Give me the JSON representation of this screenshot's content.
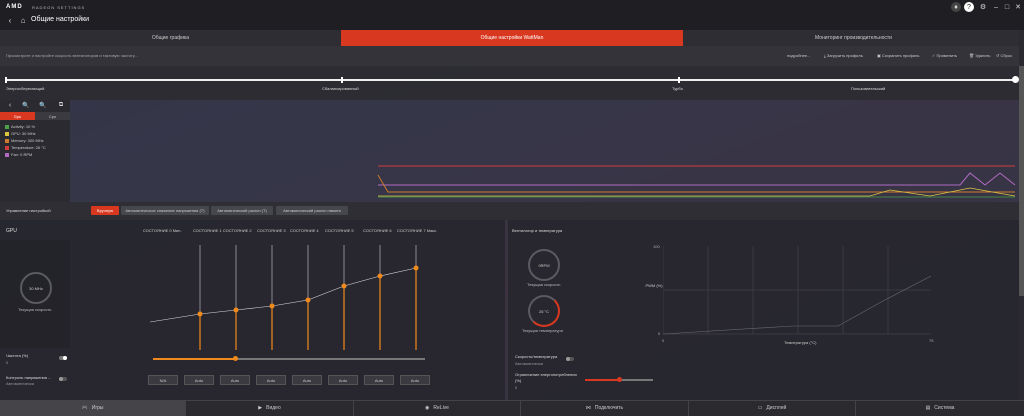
{
  "app": {
    "brand": "AMD",
    "product": "RADEON SETTINGS",
    "title": "Общие настройки"
  },
  "tabs": [
    {
      "label": "Общие графика"
    },
    {
      "label": "Общие настройки WattMan"
    },
    {
      "label": "Мониторинг производительности"
    }
  ],
  "toolbar": {
    "hint": "Просмотрите и настройте скорость вентиляторов и тактовую частоту...",
    "more": "подробнее...",
    "load": "Загрузить профиль",
    "save": "Сохранить профиль",
    "apply": "Применить",
    "delete": "Удалить",
    "reset": "Сброс"
  },
  "presets": {
    "items": [
      "Энергосберегающий",
      "Сбалансированный",
      "Турбо",
      "Пользовательский"
    ]
  },
  "monitor": {
    "tabs": [
      "Gpu",
      "Cpu"
    ],
    "legend": [
      {
        "label": "Activity: 10 %",
        "color": "#4aa14a"
      },
      {
        "label": "GPU: 30 MHz",
        "color": "#d9c541"
      },
      {
        "label": "Memory: 300 MHz",
        "color": "#cc7a2e"
      },
      {
        "label": "Temperature: 26 °C",
        "color": "#d23b3b"
      },
      {
        "label": "Fan: 0 RPM",
        "color": "#b06ac0"
      }
    ]
  },
  "controls": {
    "label": "Управление настройкой",
    "buttons": [
      "Вручную",
      "Автоматическое снижение напряжения (T)",
      "Автоматический разгон (T)",
      "Автоматический разгон памяти"
    ]
  },
  "gpu": {
    "title": "GPU",
    "speed_label": "Текущая скорость",
    "speed_value": "30 MHz",
    "states": [
      "СОСТОЯНИЕ 0 Мин.",
      "СОСТОЯНИЕ 1",
      "СОСТОЯНИЕ 2",
      "СОСТОЯНИЕ 3",
      "СОСТОЯНИЕ 4",
      "СОСТОЯНИЕ 5",
      "СОСТОЯНИЕ 6",
      "СОСТОЯНИЕ 7 Макс."
    ],
    "curve": [
      0.18,
      0.26,
      0.3,
      0.34,
      0.4,
      0.54,
      0.64,
      0.72
    ],
    "freq_label": "Частота (%)",
    "freq_value": "0",
    "freq_level": 0.3,
    "voltage_label": "Контроль напряжения ...",
    "voltage_value": "Автоматически",
    "voltage_values": [
      "N/A",
      "Auto",
      "Auto",
      "Auto",
      "Auto",
      "Auto",
      "Auto",
      "Auto"
    ]
  },
  "fan": {
    "title": "Вентилятор и температура",
    "speed_value": "0RPM",
    "speed_label": "Текущая скорость",
    "temp_value": "26 °C",
    "temp_label": "Текущая температура",
    "chart": {
      "ylabel": "PWM (%)",
      "xlabel": "Температура (°C)",
      "ymax": "100",
      "ymin": "0",
      "xmin": "0",
      "xmax": "75"
    },
    "speed_temp_label": "Скорость/температура",
    "speed_temp_value": "Автоматически",
    "power_label": "Ограничение энергопотребления (%)",
    "power_value": "0",
    "power_level": 0.5
  },
  "bottomnav": [
    {
      "label": "Игры"
    },
    {
      "label": "Видео"
    },
    {
      "label": "ReLive"
    },
    {
      "label": "Подключить"
    },
    {
      "label": "Дисплей"
    },
    {
      "label": "Система"
    }
  ],
  "colors": {
    "accent": "#d8381f",
    "curve": "#f08a1c"
  }
}
